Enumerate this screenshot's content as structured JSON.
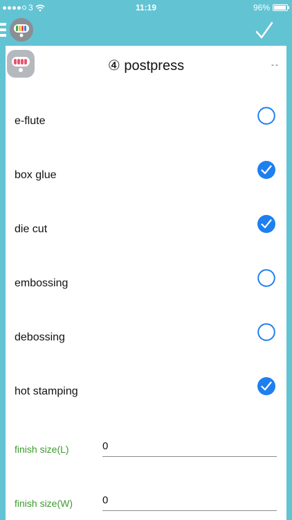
{
  "status_bar": {
    "carrier": "3",
    "time": "11:19",
    "battery": "96%",
    "battery_level": 0.96
  },
  "header": {
    "menu_icon": "hamburger-icon",
    "logo_icon": "app-logo-icon",
    "done_icon": "checkmark-icon"
  },
  "section": {
    "title": "④ postpress",
    "dashes": "--"
  },
  "options": [
    {
      "label": "e-flute",
      "checked": false
    },
    {
      "label": "box glue",
      "checked": true
    },
    {
      "label": "die cut",
      "checked": true
    },
    {
      "label": "embossing",
      "checked": false
    },
    {
      "label": "debossing",
      "checked": false
    },
    {
      "label": "hot stamping",
      "checked": true
    }
  ],
  "fields": [
    {
      "label": "finish size(L)",
      "value": "0"
    },
    {
      "label": "finish size(W)",
      "value": "0"
    }
  ],
  "colors": {
    "background": "#62c3d3",
    "check_blue": "#1e7ff0",
    "field_label_green": "#3c9a2e"
  }
}
